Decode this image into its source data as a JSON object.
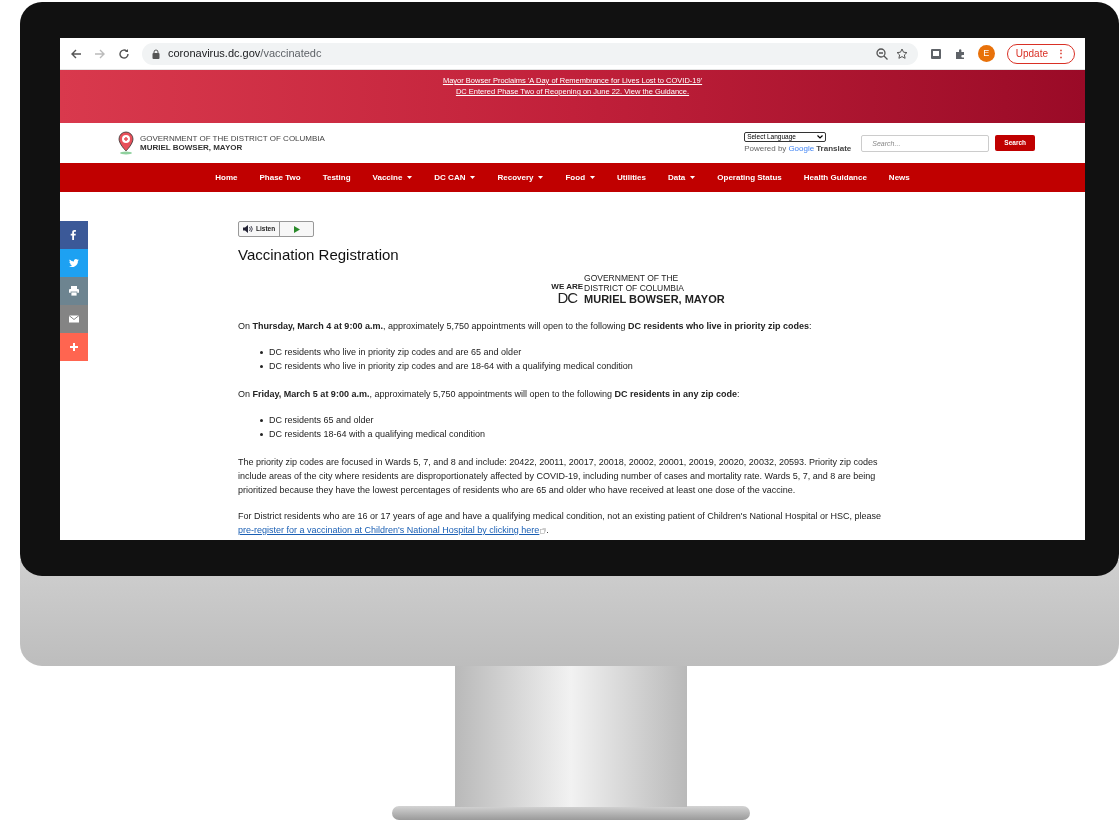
{
  "browser": {
    "url_host": "coronavirus.dc.gov",
    "url_path": "/vaccinatedc",
    "profile_initial": "E",
    "update_label": "Update",
    "menu_glyph": "⋮"
  },
  "banner": {
    "links": [
      "Mayor Bowser Proclaims 'A Day of Remembrance for Lives Lost to COVID-19'",
      "DC Entered Phase Two of Reopening on June 22. View the Guidance."
    ]
  },
  "header": {
    "logo_small": "GOVERNMENT OF THE DISTRICT OF COLUMBIA",
    "logo_big": "MURIEL BOWSER, MAYOR",
    "language_select": "Select Language",
    "powered_by": "Powered by",
    "google": "Google",
    "translate": "Translate",
    "search_placeholder": "Search...",
    "search_button": "Search"
  },
  "nav": [
    {
      "label": "Home",
      "dropdown": false
    },
    {
      "label": "Phase Two",
      "dropdown": false
    },
    {
      "label": "Testing",
      "dropdown": false
    },
    {
      "label": "Vaccine",
      "dropdown": true
    },
    {
      "label": "DC CAN",
      "dropdown": true
    },
    {
      "label": "Recovery",
      "dropdown": true
    },
    {
      "label": "Food",
      "dropdown": true
    },
    {
      "label": "Utilities",
      "dropdown": false
    },
    {
      "label": "Data",
      "dropdown": true
    },
    {
      "label": "Operating Status",
      "dropdown": false
    },
    {
      "label": "Health Guidance",
      "dropdown": false
    },
    {
      "label": "News",
      "dropdown": false
    }
  ],
  "share": [
    {
      "kind": "facebook"
    },
    {
      "kind": "twitter"
    },
    {
      "kind": "print"
    },
    {
      "kind": "email"
    },
    {
      "kind": "more"
    }
  ],
  "listen": {
    "label": "Listen"
  },
  "title": "Vaccination Registration",
  "seal": {
    "we_are": "WE ARE",
    "line_1": "GOVERNMENT OF THE",
    "line_2": "DISTRICT OF COLUMBIA",
    "dc": "DC",
    "line_3": "MURIEL BOWSER, MAYOR"
  },
  "content": [
    {
      "kind": "paragraph",
      "text": "On **Thursday, March 4 at 9:00 a.m.**, approximately 5,750 appointments will open to the following **DC residents who live in priority zip codes**:"
    },
    {
      "kind": "list",
      "items": [
        "DC residents who live in priority zip codes and are 65 and older",
        "DC residents who live in priority zip codes and are 18-64 with a qualifying medical condition"
      ]
    },
    {
      "kind": "paragraph",
      "text": "On **Friday, March 5 at 9:00 a.m.**, approximately 5,750 appointments will open to the following **DC residents in any zip code**:"
    },
    {
      "kind": "list",
      "items": [
        "DC residents 65 and older",
        "DC residents 18-64 with a qualifying medical condition"
      ]
    },
    {
      "kind": "paragraph",
      "text": "The priority zip codes are focused in Wards 5, 7, and 8 and include: 20422, 20011, 20017, 20018, 20002, 20001, 20019, 20020, 20032, 20593. Priority zip codes include areas of the city where residents are disproportionately affected by COVID-19, including number of cases and mortality rate. Wards 5, 7, and 8 are being prioritized because they have the lowest percentages of residents who are 65 and older who have received at least one dose of the vaccine."
    },
    {
      "kind": "link_paragraph",
      "before": "For District residents who are 16 or 17 years of age and have a qualifying medical condition, not an existing patient of Children's National Hospital or HSC, please",
      "link": "pre-register for a vaccination at Children's National Hospital by clicking here",
      "after": "."
    }
  ]
}
